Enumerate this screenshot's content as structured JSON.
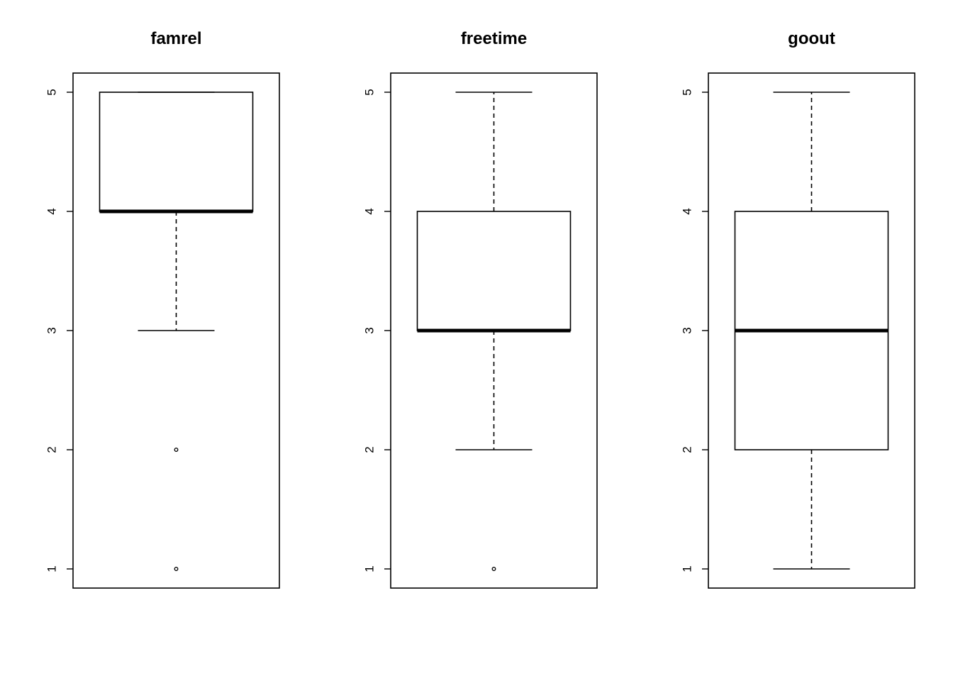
{
  "chart_data": [
    {
      "type": "boxplot",
      "title": "famrel",
      "ylim": [
        1,
        5
      ],
      "yticks": [
        "1",
        "2",
        "3",
        "4",
        "5"
      ],
      "whisker_low": 3,
      "q1": 4,
      "median": 4,
      "q3": 5,
      "whisker_high": 5,
      "outliers": [
        2,
        1
      ]
    },
    {
      "type": "boxplot",
      "title": "freetime",
      "ylim": [
        1,
        5
      ],
      "yticks": [
        "1",
        "2",
        "3",
        "4",
        "5"
      ],
      "whisker_low": 2,
      "q1": 3,
      "median": 3,
      "q3": 4,
      "whisker_high": 5,
      "outliers": [
        1
      ]
    },
    {
      "type": "boxplot",
      "title": "goout",
      "ylim": [
        1,
        5
      ],
      "yticks": [
        "1",
        "2",
        "3",
        "4",
        "5"
      ],
      "whisker_low": 1,
      "q1": 2,
      "median": 3,
      "q3": 4,
      "whisker_high": 5,
      "outliers": []
    }
  ],
  "colors": {
    "ink": "#000000",
    "background": "#ffffff"
  }
}
